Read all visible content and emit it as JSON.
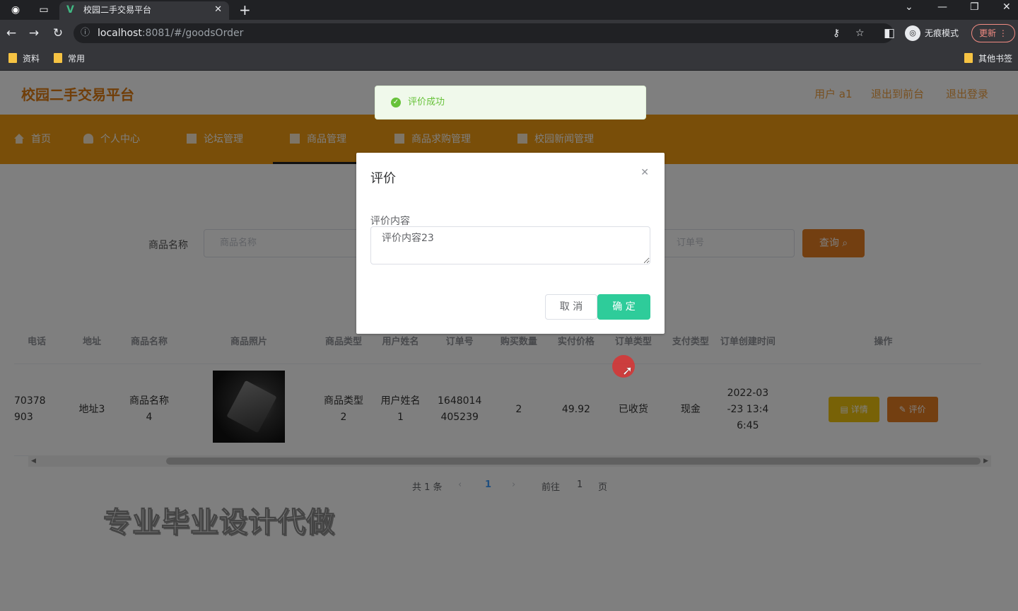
{
  "browser": {
    "tab_title": "校园二手交易平台",
    "url_host": "localhost",
    "url_path": ":8081/#/goodsOrder",
    "profile_label": "无痕模式",
    "update_label": "更新",
    "bookmarks": [
      "资料",
      "常用"
    ],
    "other_bookmarks": "其他书签"
  },
  "header": {
    "logo": "校园二手交易平台",
    "user": "用户 a1",
    "back_to_admin": "退出到前台",
    "logout": "退出登录"
  },
  "nav": {
    "items": [
      "首页",
      "个人中心",
      "论坛管理",
      "商品管理",
      "商品求购管理",
      "校园新闻管理"
    ],
    "active": "商品管理"
  },
  "search": {
    "label": "商品名称",
    "placeholder": "商品名称",
    "placeholder2": "订单号",
    "query_button": "查询"
  },
  "table": {
    "headers": [
      "电话",
      "地址",
      "商品名称",
      "商品照片",
      "商品类型",
      "用户姓名",
      "订单号",
      "购买数量",
      "实付价格",
      "订单类型",
      "支付类型",
      "订单创建时间",
      "操作"
    ],
    "row": {
      "phone": "70378\n903",
      "address": "地址3",
      "goods_name": "商品名称\n4",
      "goods_type": "商品类型\n2",
      "user_name": "用户姓名\n1",
      "order_no": "1648014\n405239",
      "quantity": "2",
      "price": "49.92",
      "order_type": "已收货",
      "pay_type": "现金",
      "created": "2022-03\n-23 13:4\n6:45",
      "detail_btn": "详情",
      "review_btn": "评价"
    }
  },
  "pager": {
    "total": "共 1 条",
    "current": "1",
    "goto_prefix": "前往",
    "goto_value": "1",
    "goto_suffix": "页"
  },
  "watermark": "专业毕业设计代做",
  "toast": {
    "message": "评价成功",
    "color": "#67c23a"
  },
  "dialog": {
    "title": "评价",
    "field_label": "评价内容",
    "field_value": "评价内容23",
    "cancel": "取 消",
    "confirm": "确 定"
  }
}
